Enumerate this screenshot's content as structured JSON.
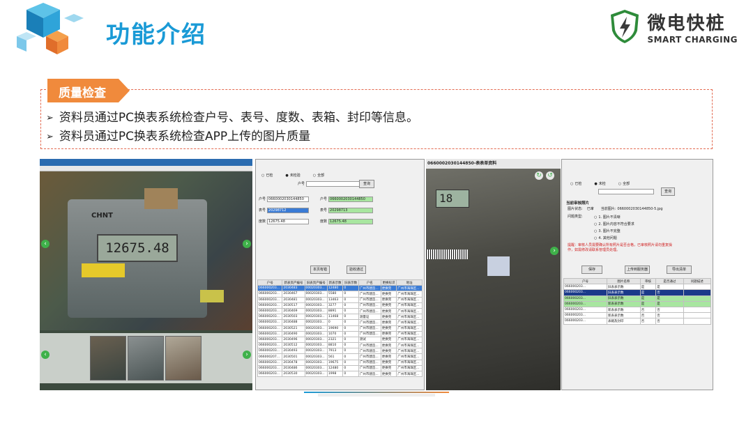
{
  "slide": {
    "title": "功能介绍",
    "brand_cn": "微电快桩",
    "brand_en": "SMART CHARGING",
    "tag_label": "质量检查",
    "bullets": [
      "资料员通过PC换表系统检查户号、表号、度数、表箱、封印等信息。",
      "资料员通过PC换表系统检查APP上传的图片质量"
    ]
  },
  "screens": {
    "left_meter_reading": "12675.48",
    "left_meter_brand": "CHNT",
    "form": {
      "radios": [
        "已检",
        "未检验",
        "全部"
      ],
      "query_button": "查询",
      "field_labels": [
        "户号",
        "表号",
        "度数"
      ],
      "new_values": [
        "0660002030144850",
        "20298712",
        "12675.48"
      ],
      "old_values": [
        "0660002030144850",
        "20298713",
        "12675.48"
      ],
      "btn_wrong": "本页有错",
      "btn_pass": "验收通过",
      "col_headers": [
        "户号",
        "新表资产编号",
        "旧表资产编号",
        "新表示数",
        "旧表示数",
        "户名",
        "更换标识",
        "地址"
      ],
      "rows": [
        [
          "066000203...",
          "2030483",
          "00020303...",
          "12480",
          "0",
          "广州市建造...",
          "更换完",
          "广州市海珠区..."
        ],
        [
          "066000203...",
          "2030467",
          "00020303...",
          "5580",
          "0",
          "广州市建造...",
          "更换完",
          "广州市海珠区..."
        ],
        [
          "066000203...",
          "2030481",
          "00020303...",
          "13463",
          "0",
          "广州市建造...",
          "更换完",
          "广州市海珠区..."
        ],
        [
          "066000203...",
          "2030517",
          "00020303...",
          "3277",
          "0",
          "广州市建造...",
          "更换完",
          "广州市海珠区..."
        ],
        [
          "066000203...",
          "2030469",
          "00020303...",
          "8891",
          "0",
          "广州市建造...",
          "更换完",
          "广州市海珠区..."
        ],
        [
          "066000203...",
          "2030503",
          "00020303...",
          "11468",
          "0",
          "测量证",
          "更换完",
          "广州市海珠区..."
        ],
        [
          "066000203...",
          "2030488",
          "00020303...",
          "0",
          "0",
          "广州市建造...",
          "更换完",
          "广州市海珠区..."
        ],
        [
          "066000203...",
          "2030521",
          "00020303...",
          "19690",
          "0",
          "广州市建造...",
          "更换完",
          "广州市海珠区..."
        ],
        [
          "066000203...",
          "2030490",
          "00020303...",
          "1070",
          "0",
          "广州市建造...",
          "更换完",
          "广州市海珠区..."
        ],
        [
          "066000203...",
          "2030496",
          "00020303...",
          "2321",
          "0",
          "测试",
          "更换完",
          "广州市海珠区..."
        ],
        [
          "066000203...",
          "2030512",
          "00020303...",
          "8810",
          "0",
          "广州市建造...",
          "更换完",
          "广州市海珠区..."
        ],
        [
          "066000203...",
          "2030493",
          "00020303...",
          "7913",
          "0",
          "广州市建造...",
          "更换完",
          "广州市海珠区..."
        ],
        [
          "066000207...",
          "2030501",
          "00020303...",
          "561",
          "0",
          "广州市建造...",
          "更换完",
          "广州市海珠区..."
        ],
        [
          "066000203...",
          "2030478",
          "00020303...",
          "19675",
          "0",
          "广州市建造...",
          "更换完",
          "广州市海珠区..."
        ],
        [
          "066000203...",
          "2030486",
          "00020303...",
          "12480",
          "0",
          "广州市建造...",
          "更换完",
          "广州市海珠区..."
        ],
        [
          "066000203...",
          "2030530",
          "00020303...",
          "1998",
          "0",
          "广州市建造...",
          "更换完",
          "广州市海珠区..."
        ]
      ]
    },
    "photo_header": "0660002030144850-表表单资料",
    "photo_lcd": "18",
    "right": {
      "radios": [
        "已检",
        "未检",
        "全部"
      ],
      "query_button": "查询",
      "section_title": "当前审核照片",
      "status_label": "图片状态:",
      "status_value": "已审",
      "current_image_label": "当前图片:",
      "current_image_value": "0660002030144850-5.jpg",
      "issue_label": "问题类型:",
      "issues": [
        "1. 图片不清晰",
        "2. 图片内容不符合要求",
        "3. 图片不完整",
        "4. 其他问题"
      ],
      "warning": "提醒：审核人员需要确认所有照片是否合格，已审核照片请勿重复操作，如需修改请联系管理员处理。",
      "btn_save": "保存",
      "btn_upload": "上传到服务器",
      "btn_export": "导出清单",
      "col_headers": [
        "户号",
        "图片名称",
        "审核",
        "是否通过",
        "问题描述"
      ],
      "rows": [
        [
          "066000203...",
          "旧表表示数",
          "是",
          "是",
          ""
        ],
        [
          "066000203...",
          "旧表表示数",
          "是",
          "否",
          ""
        ],
        [
          "066000203...",
          "旧表表示数",
          "是",
          "是",
          ""
        ],
        [
          "066000203...",
          "新表表示数",
          "是",
          "是",
          ""
        ],
        [
          "066000203...",
          "新表表示数",
          "否",
          "否",
          ""
        ],
        [
          "066000203...",
          "新表表示数",
          "否",
          "否",
          ""
        ],
        [
          "066000203...",
          "表箱及封印",
          "否",
          "否",
          ""
        ]
      ]
    }
  },
  "colors": {
    "title": "#1a9ad6",
    "tag": "#f08a3c",
    "dashed_border": "#e36a50",
    "nav_button": "#3fb14a"
  }
}
